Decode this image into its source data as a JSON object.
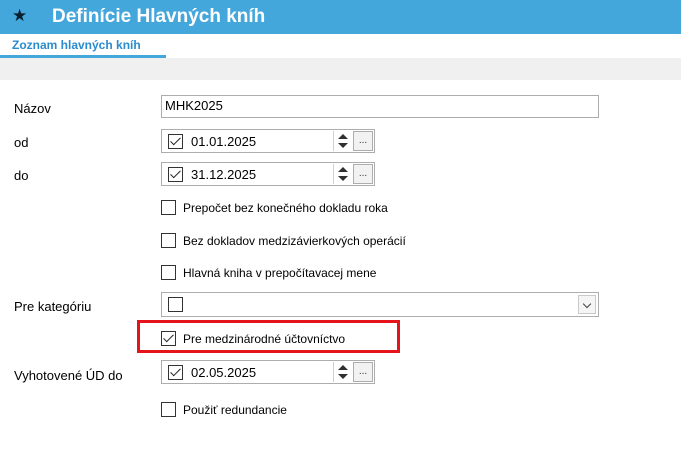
{
  "window": {
    "star_icon": "star-icon",
    "title": "Definície Hlavných kníh"
  },
  "tabs": [
    {
      "label": "Zoznam hlavných kníh",
      "active": true
    }
  ],
  "form": {
    "name": {
      "label": "Názov",
      "value": "MHK2025"
    },
    "from": {
      "label": "od",
      "checked": true,
      "value": "01.01.2025"
    },
    "to": {
      "label": "do",
      "checked": true,
      "value": "31.12.2025"
    },
    "recalc_no_final": {
      "label": "Prepočet bez konečného dokladu roka",
      "checked": false
    },
    "no_intercompany": {
      "label": "Bez dokladov medzizávierkových operácií",
      "checked": false
    },
    "recalc_currency": {
      "label": "Hlavná kniha v prepočítavacej mene",
      "checked": false
    },
    "category": {
      "label": "Pre kategóriu",
      "checked": false,
      "value": ""
    },
    "international": {
      "label": "Pre medzinárodné účtovníctvo",
      "checked": true,
      "highlighted": true
    },
    "generated_to": {
      "label": "Vyhotovené ÚD do",
      "checked": true,
      "value": "02.05.2025"
    },
    "use_redundancy": {
      "label": "Použiť redundancie",
      "checked": false
    }
  },
  "ellipsis_label": "...",
  "colors": {
    "accent": "#43a7dc",
    "tab_text": "#2a8ccc",
    "highlight_box": "#e5141b"
  }
}
